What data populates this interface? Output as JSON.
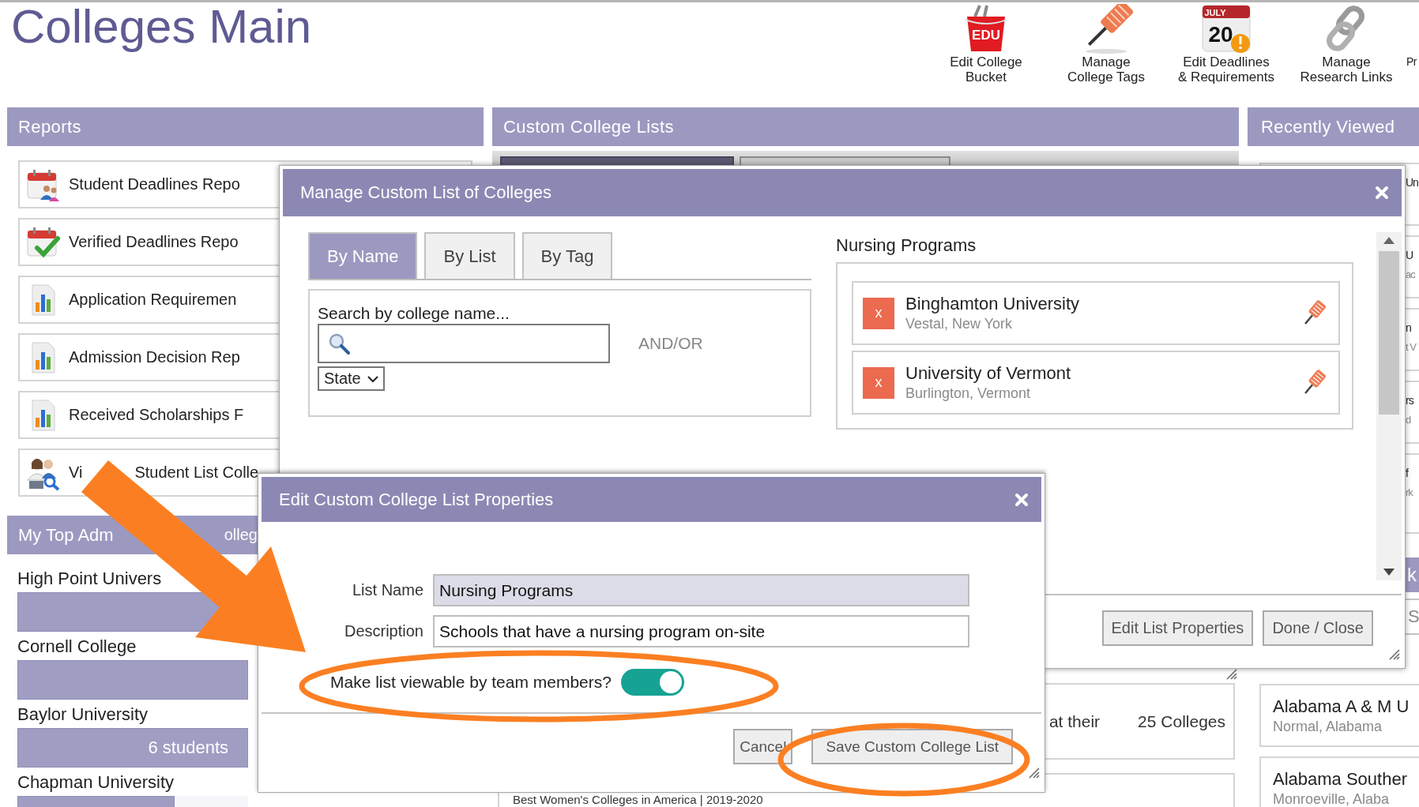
{
  "page_title": "Colleges Main",
  "toolbar": [
    {
      "kind": "bucket",
      "lines": [
        "Edit College",
        "Bucket"
      ],
      "icon_text": "EDU"
    },
    {
      "kind": "pin",
      "lines": [
        "Manage",
        "College Tags"
      ]
    },
    {
      "kind": "calendar",
      "lines": [
        "Edit Deadlines",
        "& Requirements"
      ],
      "icon_month": "JULY",
      "icon_day": "20"
    },
    {
      "kind": "link",
      "lines": [
        "Manage",
        "Research Links"
      ]
    },
    {
      "kind": "partial",
      "lines": [
        "Pr"
      ]
    }
  ],
  "reports": {
    "title": "Reports",
    "items": [
      {
        "kind": "calendar-people",
        "label": "Student Deadlines Repo"
      },
      {
        "kind": "calendar-check",
        "label": "Verified Deadlines Repo"
      },
      {
        "kind": "chart",
        "label": "Application Requiremen"
      },
      {
        "kind": "chart",
        "label": "Admission Decision Rep"
      },
      {
        "kind": "chart",
        "label": "Received Scholarships F"
      },
      {
        "kind": "people-search",
        "label": "Vi",
        "label_after": "Student List Colle"
      }
    ]
  },
  "top_admitted": {
    "title": "My Top Adm",
    "title_after": "olleg",
    "colleges": [
      {
        "name": "High Point Univers",
        "level": 1
      },
      {
        "name": "Cornell College",
        "level": 1
      },
      {
        "name": "Baylor University",
        "level": 1,
        "count": "6 students"
      },
      {
        "name": "Chapman University",
        "level": 0.68
      }
    ]
  },
  "custom_lists": {
    "title": "Custom College Lists",
    "tabs": [
      {
        "selected": true
      },
      {
        "selected": false
      }
    ],
    "cards": [
      {
        "text": "at their",
        "count": "25 Colleges"
      },
      {
        "text": "Best Women's Colleges in America | 2019-2020"
      }
    ]
  },
  "recently_viewed": {
    "title": "Recently Viewed",
    "hidden_items": [
      {
        "name": "Un"
      },
      {
        "name": "U",
        "sub": "ac"
      },
      {
        "name": "n",
        "sub": "t V"
      },
      {
        "name": "rs",
        "sub": "d"
      },
      {
        "name": "f",
        "sub": "rk"
      }
    ],
    "section_title": "k",
    "search_text": "S",
    "items": [
      {
        "name": "Alabama A & M U",
        "location": "Normal, Alabama"
      },
      {
        "name": "Alabama Souther",
        "location": "Monroeville, Alaba"
      }
    ]
  },
  "manage_dialog": {
    "title": "Manage Custom List of Colleges",
    "tabs": [
      {
        "label": "By Name",
        "selected": true
      },
      {
        "label": "By List",
        "selected": false
      },
      {
        "label": "By Tag",
        "selected": false
      }
    ],
    "search_label": "Search by college name...",
    "and_or": "AND/OR",
    "state_select": "State",
    "list_title": "Nursing Programs",
    "list_items": [
      {
        "name": "Binghamton University",
        "location": "Vestal, New York",
        "remove": "x"
      },
      {
        "name": "University of Vermont",
        "location": "Burlington, Vermont",
        "remove": "x"
      }
    ],
    "buttons": [
      "Edit List Properties",
      "Done / Close"
    ]
  },
  "edit_dialog": {
    "title": "Edit Custom College List Properties",
    "fields": [
      {
        "label": "List Name",
        "value": "Nursing Programs",
        "readonly": true
      },
      {
        "label": "Description",
        "value": "Schools that have a nursing program on-site",
        "readonly": false
      }
    ],
    "toggle": {
      "label": "Make list viewable by team members?",
      "on": true
    },
    "buttons": [
      "Cancel",
      "Save Custom College List"
    ]
  }
}
